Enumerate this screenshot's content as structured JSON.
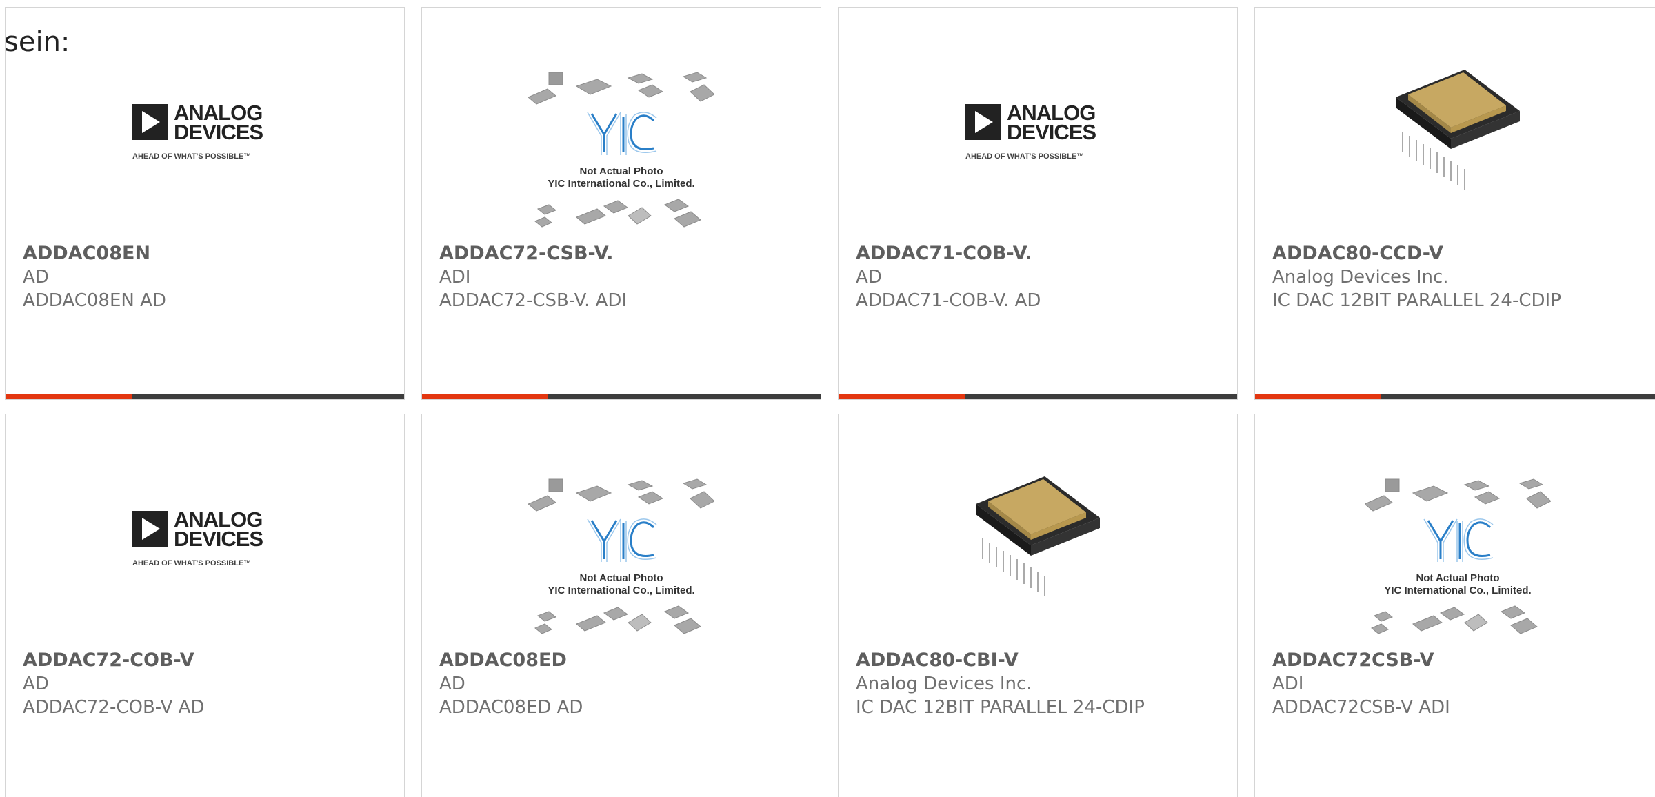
{
  "intro_text": "sein:",
  "logo": {
    "word1": "ANALOG",
    "word2": "DEVICES",
    "tagline": "AHEAD OF WHAT'S POSSIBLE™"
  },
  "placeholder": {
    "brand": "YIC",
    "line1": "Not Actual Photo",
    "line2": "YIC International Co., Limited."
  },
  "accent_colors": {
    "bar_accent": "#e33610",
    "bar_base": "#3d3d3d"
  },
  "products": [
    {
      "part": "ADDAC08EN",
      "manufacturer": "AD",
      "description": "ADDAC08EN AD",
      "image": "adi-logo"
    },
    {
      "part": "ADDAC72-CSB-V.",
      "manufacturer": "ADI",
      "description": "ADDAC72-CSB-V. ADI",
      "image": "placeholder"
    },
    {
      "part": "ADDAC71-COB-V.",
      "manufacturer": "AD",
      "description": "ADDAC71-COB-V. AD",
      "image": "adi-logo"
    },
    {
      "part": "ADDAC80-CCD-V",
      "manufacturer": "Analog Devices Inc.",
      "description": "IC DAC 12BIT PARALLEL 24-CDIP",
      "image": "dip-chip"
    },
    {
      "part": "ADDAC72-COB-V",
      "manufacturer": "AD",
      "description": "ADDAC72-COB-V AD",
      "image": "adi-logo"
    },
    {
      "part": "ADDAC08ED",
      "manufacturer": "AD",
      "description": "ADDAC08ED AD",
      "image": "placeholder"
    },
    {
      "part": "ADDAC80-CBI-V",
      "manufacturer": "Analog Devices Inc.",
      "description": "IC DAC 12BIT PARALLEL 24-CDIP",
      "image": "dip-chip"
    },
    {
      "part": "ADDAC72CSB-V",
      "manufacturer": "ADI",
      "description": "ADDAC72CSB-V ADI",
      "image": "placeholder"
    }
  ]
}
